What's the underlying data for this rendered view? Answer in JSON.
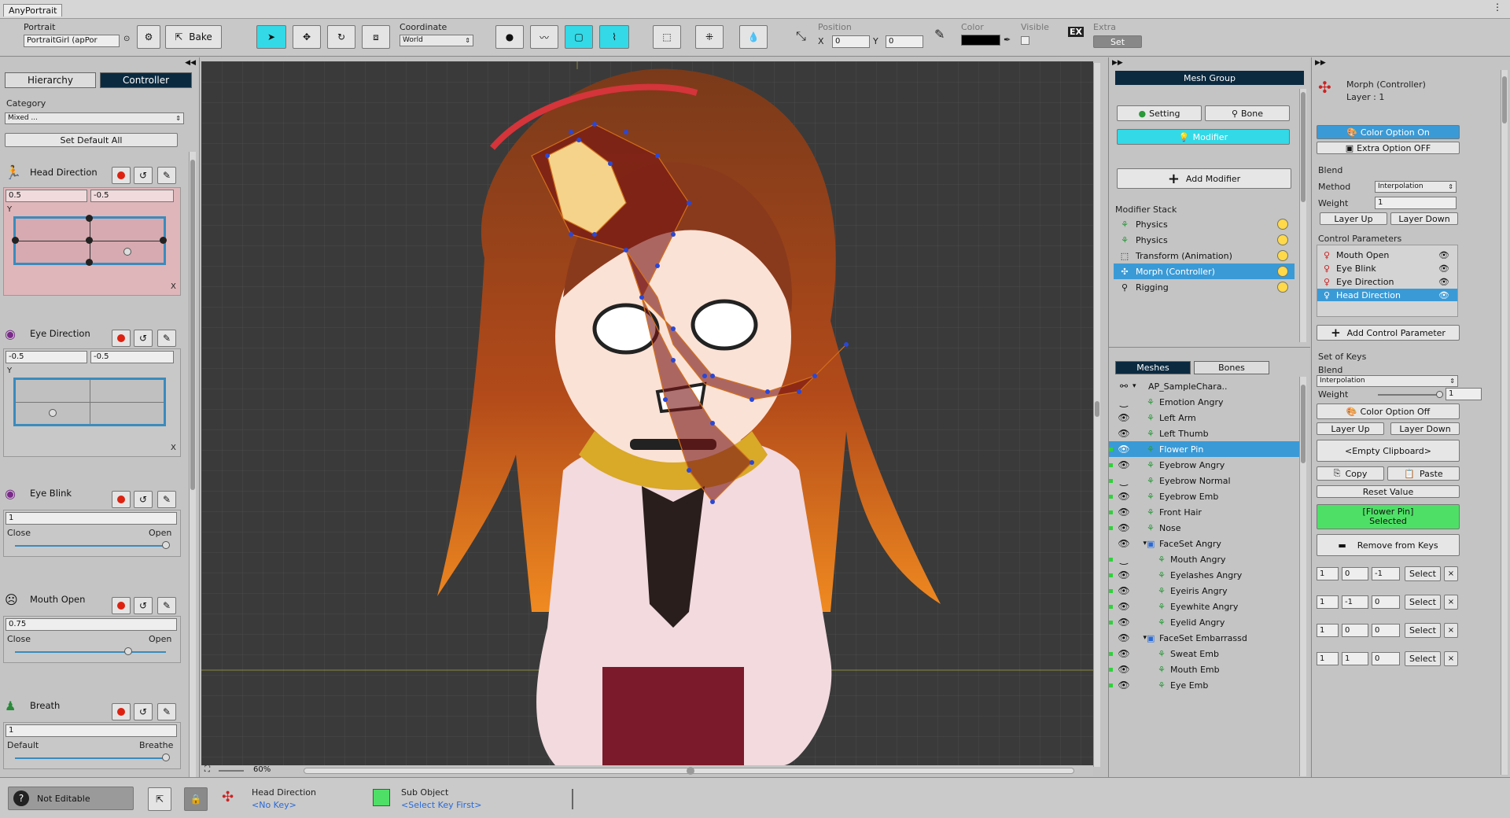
{
  "window": {
    "tab": "AnyPortrait"
  },
  "toolbar": {
    "portrait_label": "Portrait",
    "portrait_value": "PortraitGirl (apPor",
    "bake_label": "Bake",
    "coordinate_label": "Coordinate",
    "coordinate_value": "World",
    "position_label": "Position",
    "x_label": "X",
    "x_value": "0",
    "y_label": "Y",
    "y_value": "0",
    "color_label": "Color",
    "visible_label": "Visible",
    "extra_label": "Extra",
    "set_label": "Set"
  },
  "left": {
    "tab_hierarchy": "Hierarchy",
    "tab_controller": "Controller",
    "category_label": "Category",
    "category_value": "Mixed ...",
    "set_default_all": "Set Default All",
    "controls": [
      {
        "name": "Head Direction",
        "x": "0.5",
        "y": "-0.5",
        "axis_y": "Y",
        "axis_x": "X",
        "pad_x": 0.5,
        "pad_y": -0.5
      },
      {
        "name": "Eye Direction",
        "x": "-0.5",
        "y": "-0.5",
        "axis_y": "Y",
        "axis_x": "X",
        "pad_x": -0.5,
        "pad_y": -0.5
      },
      {
        "name": "Eye Blink",
        "value": "1",
        "left": "Close",
        "right": "Open",
        "level": 1
      },
      {
        "name": "Mouth Open",
        "value": "0.75",
        "left": "Close",
        "right": "Open",
        "level": 0.75
      },
      {
        "name": "Breath",
        "value": "1",
        "left": "Default",
        "right": "Breathe",
        "level": 1
      }
    ]
  },
  "viewport": {
    "zoom": "60%"
  },
  "mid": {
    "header": "Mesh Group",
    "setting": "Setting",
    "bone": "Bone",
    "modifier": "Modifier",
    "add_modifier": "Add Modifier",
    "stack_label": "Modifier Stack",
    "stack": [
      "Physics",
      "Physics",
      "Transform (Animation)",
      "Morph (Controller)",
      "Rigging"
    ],
    "tab_meshes": "Meshes",
    "tab_bones": "Bones",
    "tree": [
      "AP_SampleChara..",
      "Emotion Angry",
      "Left Arm",
      "Left Thumb",
      "Flower Pin",
      "Eyebrow Angry",
      "Eyebrow Normal",
      "Eyebrow Emb",
      "Front Hair",
      "Nose",
      "FaceSet Angry",
      "Mouth Angry",
      "Eyelashes Angry",
      "Eyeiris Angry",
      "Eyewhite Angry",
      "Eyelid Angry",
      "FaceSet Embarrassd",
      "Sweat Emb",
      "Mouth Emb",
      "Eye Emb"
    ]
  },
  "right": {
    "title": "Morph (Controller)",
    "layer": "Layer : 1",
    "color_option_on": "Color Option On",
    "extra_option_off": "Extra Option OFF",
    "blend": "Blend",
    "method": "Method",
    "method_value": "Interpolation",
    "weight": "Weight",
    "weight_value": "1",
    "layer_up": "Layer Up",
    "layer_down": "Layer Down",
    "control_parameters": "Control Parameters",
    "params": [
      "Mouth Open",
      "Eye Blink",
      "Eye Direction",
      "Head Direction"
    ],
    "add_control_parameter": "Add Control Parameter",
    "set_of_keys": "Set of Keys",
    "blend2": "Blend",
    "blend2_value": "Interpolation",
    "weight2": "Weight",
    "weight2_value": "1",
    "color_option_off": "Color Option Off",
    "layer_up2": "Layer Up",
    "layer_down2": "Layer Down",
    "clipboard": "<Empty Clipboard>",
    "copy": "Copy",
    "paste": "Paste",
    "reset_value": "Reset Value",
    "selected_line1": "[Flower Pin]",
    "selected_line2": "Selected",
    "remove_from_keys": "Remove from Keys",
    "key_rows": [
      [
        "1",
        "0",
        "-1"
      ],
      [
        "1",
        "-1",
        "0"
      ],
      [
        "1",
        "0",
        "0"
      ],
      [
        "1",
        "1",
        "0"
      ]
    ],
    "select": "Select"
  },
  "status": {
    "not_editable": "Not Editable",
    "head_direction": "Head Direction",
    "no_key": "<No Key>",
    "sub_object": "Sub Object",
    "select_key_first": "<Select Key First>"
  },
  "colors": {
    "accent": "#33d9e6",
    "dark_header": "#0b2a40",
    "selection": "#3a9ad6",
    "green_selected": "#4ee066"
  }
}
